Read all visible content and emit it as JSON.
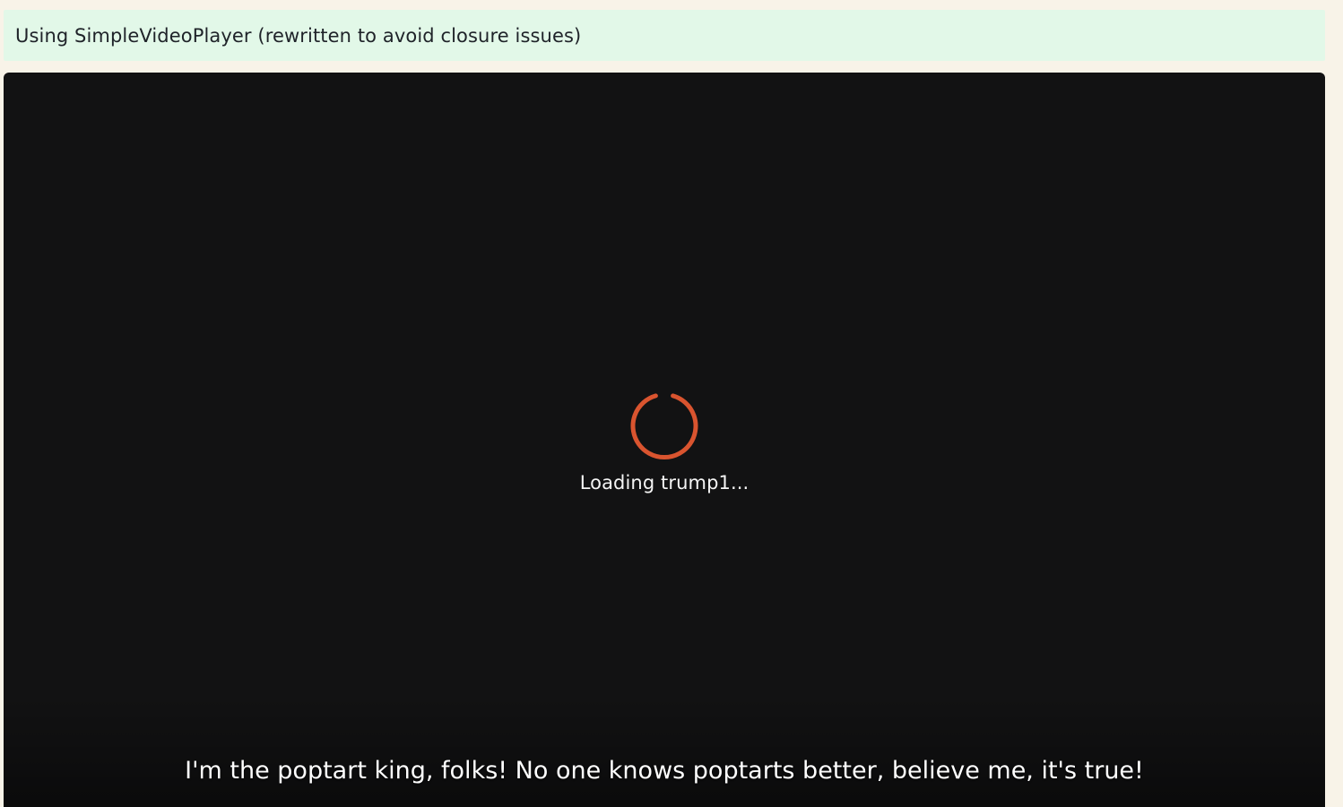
{
  "notice": {
    "text": "Using SimpleVideoPlayer (rewritten to avoid closure issues)"
  },
  "player": {
    "loading_icon": "loading-spinner-icon",
    "loading_text": "Loading trump1...",
    "subtitle": "I'm the poptart king, folks! No one knows poptarts better, believe me, it's true!"
  },
  "colors": {
    "page_background": "#f8f3e8",
    "notice_background": "#e2f8e8",
    "player_background": "#121213",
    "spinner_accent": "#d9542f",
    "text_light": "#ffffff"
  }
}
